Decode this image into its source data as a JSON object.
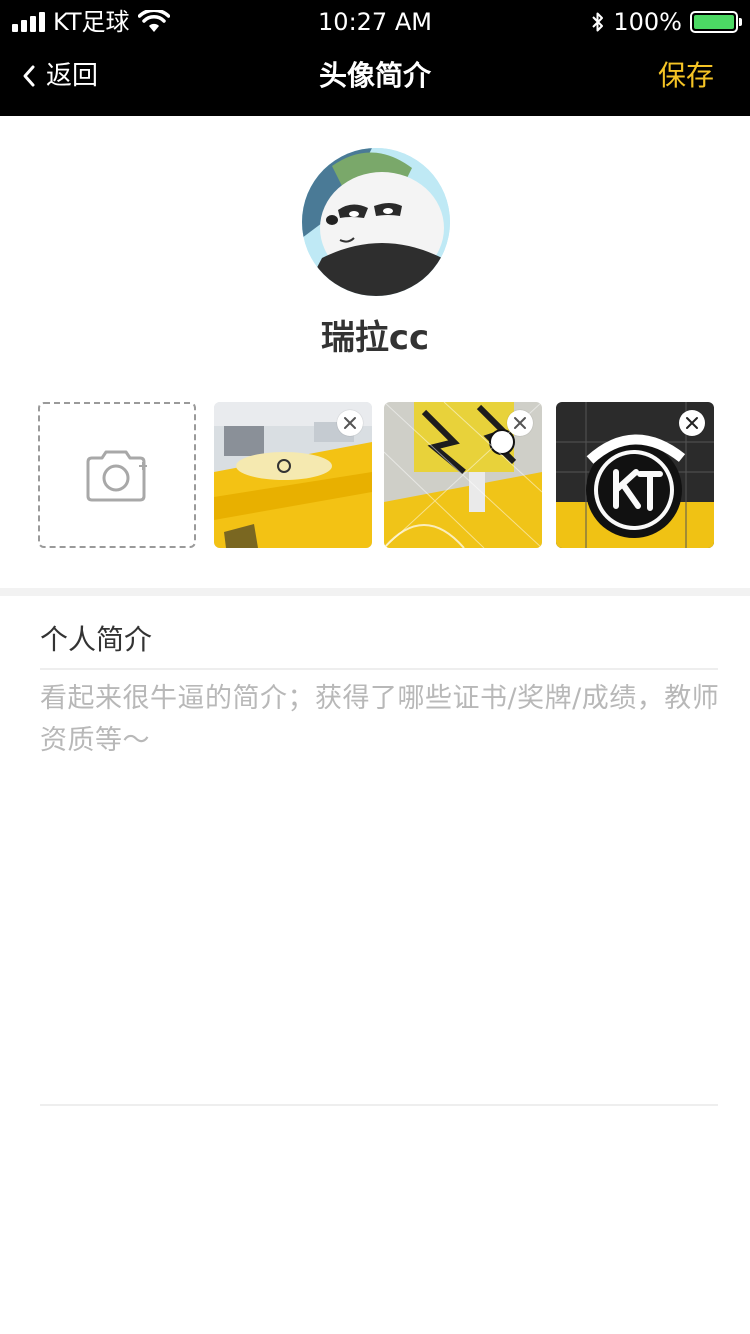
{
  "status_bar": {
    "carrier": "KT足球",
    "time": "10:27 AM",
    "battery": "100%",
    "battery_color": "#4cd964"
  },
  "nav": {
    "back_label": "返回",
    "title": "头像简介",
    "save_label": "保存",
    "accent_color": "#f5c425"
  },
  "profile": {
    "username": "瑞拉cc"
  },
  "photos": {
    "add_icon": "camera-plus-icon",
    "items": [
      {
        "name": "photo-1",
        "remove_icon": "close-icon"
      },
      {
        "name": "photo-2",
        "remove_icon": "close-icon"
      },
      {
        "name": "photo-3",
        "remove_icon": "close-icon"
      }
    ]
  },
  "intro": {
    "label": "个人简介",
    "placeholder": "看起来很牛逼的简介；获得了哪些证书/奖牌/成绩，教师资质等～"
  }
}
